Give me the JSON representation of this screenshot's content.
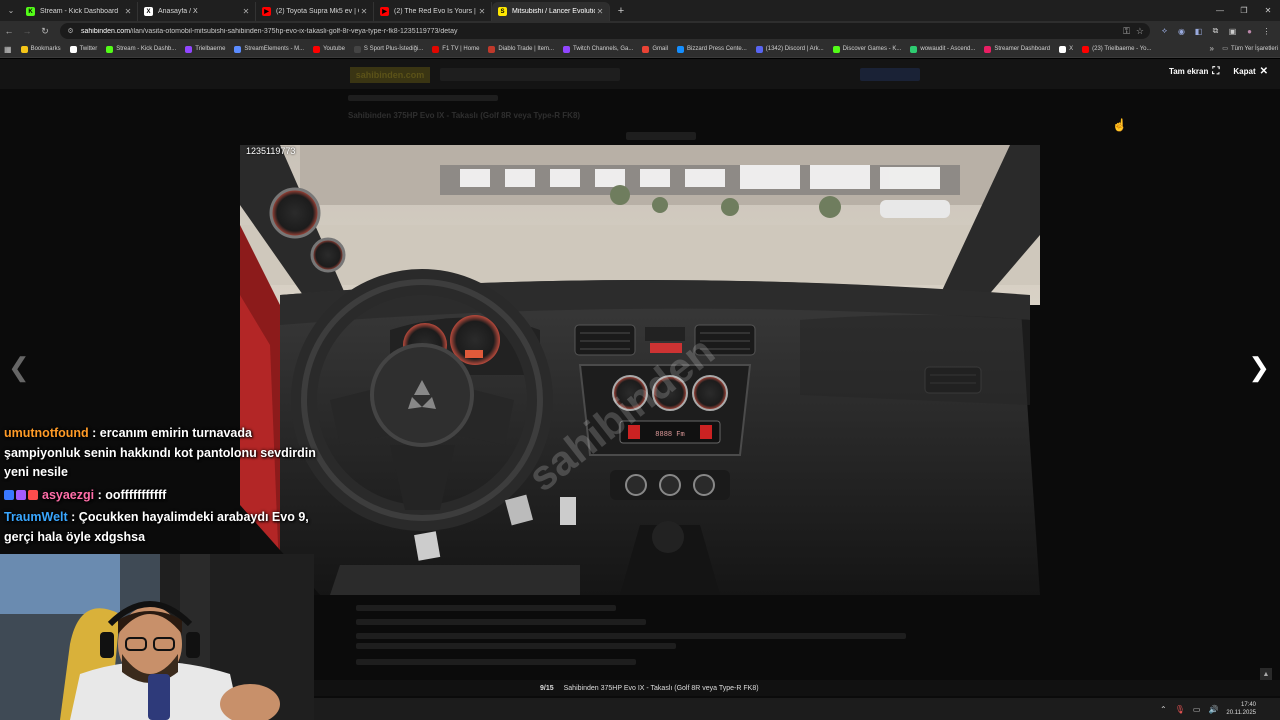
{
  "browser": {
    "tabs": [
      {
        "title": "Stream - Kick Dashboard",
        "favicon_color": "#53fc18",
        "favicon_glyph": "K",
        "active": false
      },
      {
        "title": "Anasayfa / X",
        "favicon_color": "#ffffff",
        "favicon_glyph": "X",
        "active": false
      },
      {
        "title": "(2) Toyota Supra Mk5 ev | Cine",
        "favicon_color": "#ff0000",
        "favicon_glyph": "▶",
        "active": false
      },
      {
        "title": "(2) The Red Evo Is Yours | Lanc",
        "favicon_color": "#ff0000",
        "favicon_glyph": "▶",
        "active": false
      },
      {
        "title": "Mitsubishi / Lancer Evolution /",
        "favicon_color": "#ffe800",
        "favicon_glyph": "S",
        "active": true
      }
    ],
    "url_host": "sahibinden.com",
    "url_path": "/ilan/vasita-otomobil-mitsubishi-sahibinden-375hp-evo-ix-takasli-golf-8r-veya-type-r-fk8-1235119773/detay",
    "bookmarks": [
      {
        "label": "Bookmarks",
        "color": "#f5c518"
      },
      {
        "label": "Twitter",
        "color": "#ffffff"
      },
      {
        "label": "Stream - Kick Dashb...",
        "color": "#53fc18"
      },
      {
        "label": "Trielbaerne",
        "color": "#9146ff"
      },
      {
        "label": "StreamElements - M...",
        "color": "#5b8cff"
      },
      {
        "label": "Youtube",
        "color": "#ff0000"
      },
      {
        "label": "S Sport Plus-İstediği...",
        "color": "#444444"
      },
      {
        "label": "F1 TV | Home",
        "color": "#e10600"
      },
      {
        "label": "Diablo Trade | Item...",
        "color": "#c0392b"
      },
      {
        "label": "Twitch Channels, Ga...",
        "color": "#9146ff"
      },
      {
        "label": "Gmail",
        "color": "#ea4335"
      },
      {
        "label": "Bizzard Press Cente...",
        "color": "#148eff"
      },
      {
        "label": "(1342) Discord | Ark...",
        "color": "#5865f2"
      },
      {
        "label": "Discover Games - K...",
        "color": "#53fc18"
      },
      {
        "label": "wowaudit - Ascend...",
        "color": "#2ecc71"
      },
      {
        "label": "Streamer Dashboard",
        "color": "#e91e63"
      },
      {
        "label": "X",
        "color": "#ffffff"
      },
      {
        "label": "(23) Trielbaerne - Yo...",
        "color": "#ff0000"
      }
    ],
    "all_bookmarks": "Tüm Yer İşaretleri"
  },
  "viewer": {
    "fullscreen_label": "Tam ekran",
    "close_label": "Kapat",
    "photo_id": "1235119773",
    "watermark": "sahibinden",
    "counter": "9/15",
    "caption": "Sahibinden 375HP Evo IX - Takaslı (Golf 8R veya Type-R FK8)",
    "radio_display": "8888 Fm"
  },
  "page": {
    "logo": "sahibinden.com",
    "listing_title": "Sahibinden 375HP Evo IX - Takaslı (Golf 8R veya Type-R FK8)"
  },
  "chat": [
    {
      "user": "umutnotfound",
      "text": ": ercanım emirin turnavada şampiyonluk senin hakkındı kot pantolonu sevdirdin yeni nesile",
      "badges": []
    },
    {
      "user": "asyaezgi",
      "text": ": oofffffffffff",
      "badges": [
        "#3a78ff",
        "#a45cff",
        "#ff4d4d"
      ]
    },
    {
      "user": "TraumWelt",
      "text": ": Çocukken hayalimdeki arabaydı Evo 9, gerçi hala öyle xdgshsa",
      "badges": []
    }
  ],
  "taskbar": {
    "time": "17:40",
    "date": "20.11.2025"
  }
}
